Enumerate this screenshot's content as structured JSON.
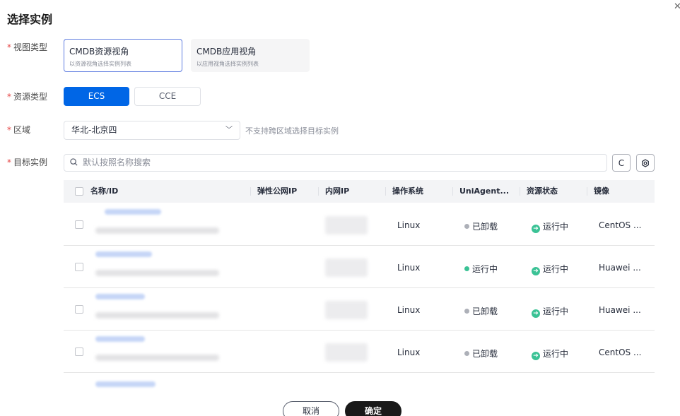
{
  "dialog": {
    "title": "选择实例",
    "close_icon": "close-icon"
  },
  "view_type": {
    "label": "视图类型",
    "options": [
      {
        "title": "CMDB资源视角",
        "subtitle": "以资源视角选择实例列表",
        "selected": true
      },
      {
        "title": "CMDB应用视角",
        "subtitle": "以应用视角选择实例列表",
        "selected": false
      }
    ]
  },
  "resource_type": {
    "label": "资源类型",
    "options": [
      "ECS",
      "CCE"
    ],
    "selected": "ECS"
  },
  "region": {
    "label": "区域",
    "value": "华北-北京四",
    "hint": "不支持跨区域选择目标实例"
  },
  "target": {
    "label": "目标实例",
    "search_placeholder": "默认按照名称搜索",
    "refresh_label": "C",
    "settings_icon": "gear-icon"
  },
  "table": {
    "columns": [
      "名称/ID",
      "弹性公网IP",
      "内网IP",
      "操作系统",
      "UniAgent...",
      "资源状态",
      "镜像"
    ],
    "rows": [
      {
        "os": "Linux",
        "agent": "已卸载",
        "agent_color": "#adb0b8",
        "status": "运行中",
        "image": "CentOS ..."
      },
      {
        "os": "Linux",
        "agent": "运行中",
        "agent_color": "#3ac295",
        "status": "运行中",
        "image": "Huawei ..."
      },
      {
        "os": "Linux",
        "agent": "已卸载",
        "agent_color": "#adb0b8",
        "status": "运行中",
        "image": "Huawei ..."
      },
      {
        "os": "Linux",
        "agent": "已卸载",
        "agent_color": "#adb0b8",
        "status": "运行中",
        "image": "CentOS ..."
      }
    ]
  },
  "footer": {
    "cancel": "取消",
    "confirm": "确定"
  },
  "colors": {
    "primary": "#0066e6",
    "required": "#e54545",
    "running": "#3ac295",
    "uninstalled": "#adb0b8"
  }
}
